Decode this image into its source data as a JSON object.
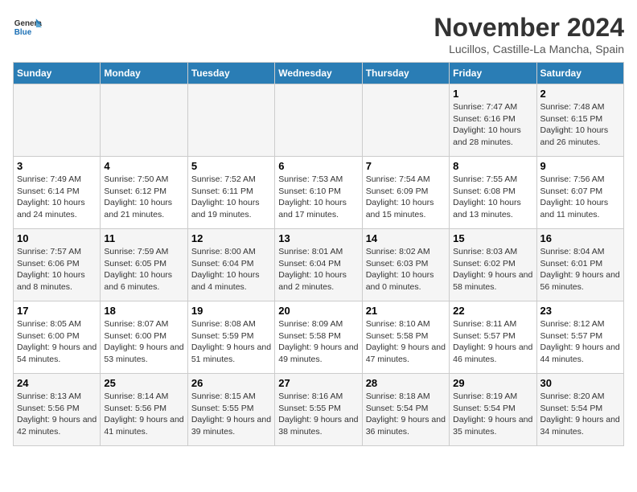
{
  "logo": {
    "general": "General",
    "blue": "Blue"
  },
  "title": "November 2024",
  "location": "Lucillos, Castille-La Mancha, Spain",
  "days_header": [
    "Sunday",
    "Monday",
    "Tuesday",
    "Wednesday",
    "Thursday",
    "Friday",
    "Saturday"
  ],
  "weeks": [
    [
      {
        "day": "",
        "info": ""
      },
      {
        "day": "",
        "info": ""
      },
      {
        "day": "",
        "info": ""
      },
      {
        "day": "",
        "info": ""
      },
      {
        "day": "",
        "info": ""
      },
      {
        "day": "1",
        "info": "Sunrise: 7:47 AM\nSunset: 6:16 PM\nDaylight: 10 hours and 28 minutes."
      },
      {
        "day": "2",
        "info": "Sunrise: 7:48 AM\nSunset: 6:15 PM\nDaylight: 10 hours and 26 minutes."
      }
    ],
    [
      {
        "day": "3",
        "info": "Sunrise: 7:49 AM\nSunset: 6:14 PM\nDaylight: 10 hours and 24 minutes."
      },
      {
        "day": "4",
        "info": "Sunrise: 7:50 AM\nSunset: 6:12 PM\nDaylight: 10 hours and 21 minutes."
      },
      {
        "day": "5",
        "info": "Sunrise: 7:52 AM\nSunset: 6:11 PM\nDaylight: 10 hours and 19 minutes."
      },
      {
        "day": "6",
        "info": "Sunrise: 7:53 AM\nSunset: 6:10 PM\nDaylight: 10 hours and 17 minutes."
      },
      {
        "day": "7",
        "info": "Sunrise: 7:54 AM\nSunset: 6:09 PM\nDaylight: 10 hours and 15 minutes."
      },
      {
        "day": "8",
        "info": "Sunrise: 7:55 AM\nSunset: 6:08 PM\nDaylight: 10 hours and 13 minutes."
      },
      {
        "day": "9",
        "info": "Sunrise: 7:56 AM\nSunset: 6:07 PM\nDaylight: 10 hours and 11 minutes."
      }
    ],
    [
      {
        "day": "10",
        "info": "Sunrise: 7:57 AM\nSunset: 6:06 PM\nDaylight: 10 hours and 8 minutes."
      },
      {
        "day": "11",
        "info": "Sunrise: 7:59 AM\nSunset: 6:05 PM\nDaylight: 10 hours and 6 minutes."
      },
      {
        "day": "12",
        "info": "Sunrise: 8:00 AM\nSunset: 6:04 PM\nDaylight: 10 hours and 4 minutes."
      },
      {
        "day": "13",
        "info": "Sunrise: 8:01 AM\nSunset: 6:04 PM\nDaylight: 10 hours and 2 minutes."
      },
      {
        "day": "14",
        "info": "Sunrise: 8:02 AM\nSunset: 6:03 PM\nDaylight: 10 hours and 0 minutes."
      },
      {
        "day": "15",
        "info": "Sunrise: 8:03 AM\nSunset: 6:02 PM\nDaylight: 9 hours and 58 minutes."
      },
      {
        "day": "16",
        "info": "Sunrise: 8:04 AM\nSunset: 6:01 PM\nDaylight: 9 hours and 56 minutes."
      }
    ],
    [
      {
        "day": "17",
        "info": "Sunrise: 8:05 AM\nSunset: 6:00 PM\nDaylight: 9 hours and 54 minutes."
      },
      {
        "day": "18",
        "info": "Sunrise: 8:07 AM\nSunset: 6:00 PM\nDaylight: 9 hours and 53 minutes."
      },
      {
        "day": "19",
        "info": "Sunrise: 8:08 AM\nSunset: 5:59 PM\nDaylight: 9 hours and 51 minutes."
      },
      {
        "day": "20",
        "info": "Sunrise: 8:09 AM\nSunset: 5:58 PM\nDaylight: 9 hours and 49 minutes."
      },
      {
        "day": "21",
        "info": "Sunrise: 8:10 AM\nSunset: 5:58 PM\nDaylight: 9 hours and 47 minutes."
      },
      {
        "day": "22",
        "info": "Sunrise: 8:11 AM\nSunset: 5:57 PM\nDaylight: 9 hours and 46 minutes."
      },
      {
        "day": "23",
        "info": "Sunrise: 8:12 AM\nSunset: 5:57 PM\nDaylight: 9 hours and 44 minutes."
      }
    ],
    [
      {
        "day": "24",
        "info": "Sunrise: 8:13 AM\nSunset: 5:56 PM\nDaylight: 9 hours and 42 minutes."
      },
      {
        "day": "25",
        "info": "Sunrise: 8:14 AM\nSunset: 5:56 PM\nDaylight: 9 hours and 41 minutes."
      },
      {
        "day": "26",
        "info": "Sunrise: 8:15 AM\nSunset: 5:55 PM\nDaylight: 9 hours and 39 minutes."
      },
      {
        "day": "27",
        "info": "Sunrise: 8:16 AM\nSunset: 5:55 PM\nDaylight: 9 hours and 38 minutes."
      },
      {
        "day": "28",
        "info": "Sunrise: 8:18 AM\nSunset: 5:54 PM\nDaylight: 9 hours and 36 minutes."
      },
      {
        "day": "29",
        "info": "Sunrise: 8:19 AM\nSunset: 5:54 PM\nDaylight: 9 hours and 35 minutes."
      },
      {
        "day": "30",
        "info": "Sunrise: 8:20 AM\nSunset: 5:54 PM\nDaylight: 9 hours and 34 minutes."
      }
    ]
  ]
}
